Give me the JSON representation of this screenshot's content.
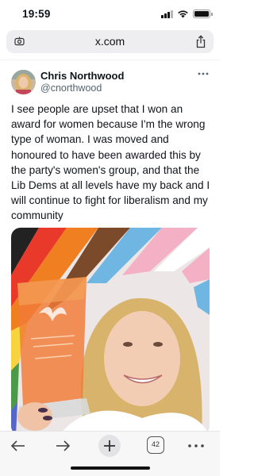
{
  "status_bar": {
    "time": "19:59"
  },
  "browser": {
    "url": "x.com",
    "tab_count": "42"
  },
  "tweet": {
    "author_name": "Chris Northwood",
    "author_handle": "@cnorthwood",
    "text": "I see people are upset that I won an award for women because I'm the wrong type of woman. I was moved and honoured to have been awarded this by the party's women's group, and that the Lib Dems at all levels have my back and I will continue to fight for liberalism and my community"
  },
  "colors": {
    "text_primary": "#0f1419",
    "text_secondary": "#536471",
    "url_bar_bg": "#eeeef0",
    "toolbar_bg": "#f7f7f8"
  },
  "icons": [
    "site-settings-icon",
    "share-icon",
    "more-options-icon",
    "back-arrow-icon",
    "forward-arrow-icon",
    "plus-icon",
    "tabs-icon",
    "more-menu-icon"
  ]
}
